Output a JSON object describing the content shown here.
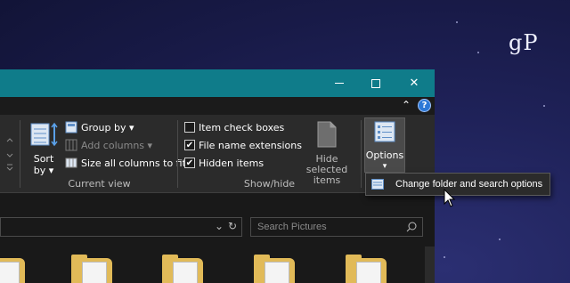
{
  "watermark": "gP",
  "window": {
    "controls": {
      "minimize": "minimize",
      "maximize": "maximize",
      "close": "✕"
    },
    "help": "?",
    "collapse_ribbon": "⌃"
  },
  "ribbon": {
    "sort_by": {
      "line1": "Sort",
      "line2": "by ▾"
    },
    "current_view": {
      "label": "Current view",
      "group_by": "Group by ▾",
      "add_columns": "Add columns ▾",
      "size_all_columns": "Size all columns to fit"
    },
    "show_hide": {
      "label": "Show/hide",
      "item_check_boxes": {
        "label": "Item check boxes",
        "checked": false
      },
      "file_name_extensions": {
        "label": "File name extensions",
        "checked": true
      },
      "hidden_items": {
        "label": "Hidden items",
        "checked": true
      },
      "hide_selected": {
        "line1": "Hide selected",
        "line2": "items"
      }
    },
    "options": {
      "label": "Options",
      "arrow": "▾"
    }
  },
  "options_menu": {
    "change_folder_options": "Change folder and search options"
  },
  "address_bar": {
    "dropdown": "⌄",
    "refresh": "↻"
  },
  "search": {
    "placeholder": "Search Pictures"
  },
  "colors": {
    "titlebar": "#0f7c8a",
    "ribbon": "#2b2b2b",
    "explorer_bg": "#191919",
    "folder": "#e1ba58"
  }
}
